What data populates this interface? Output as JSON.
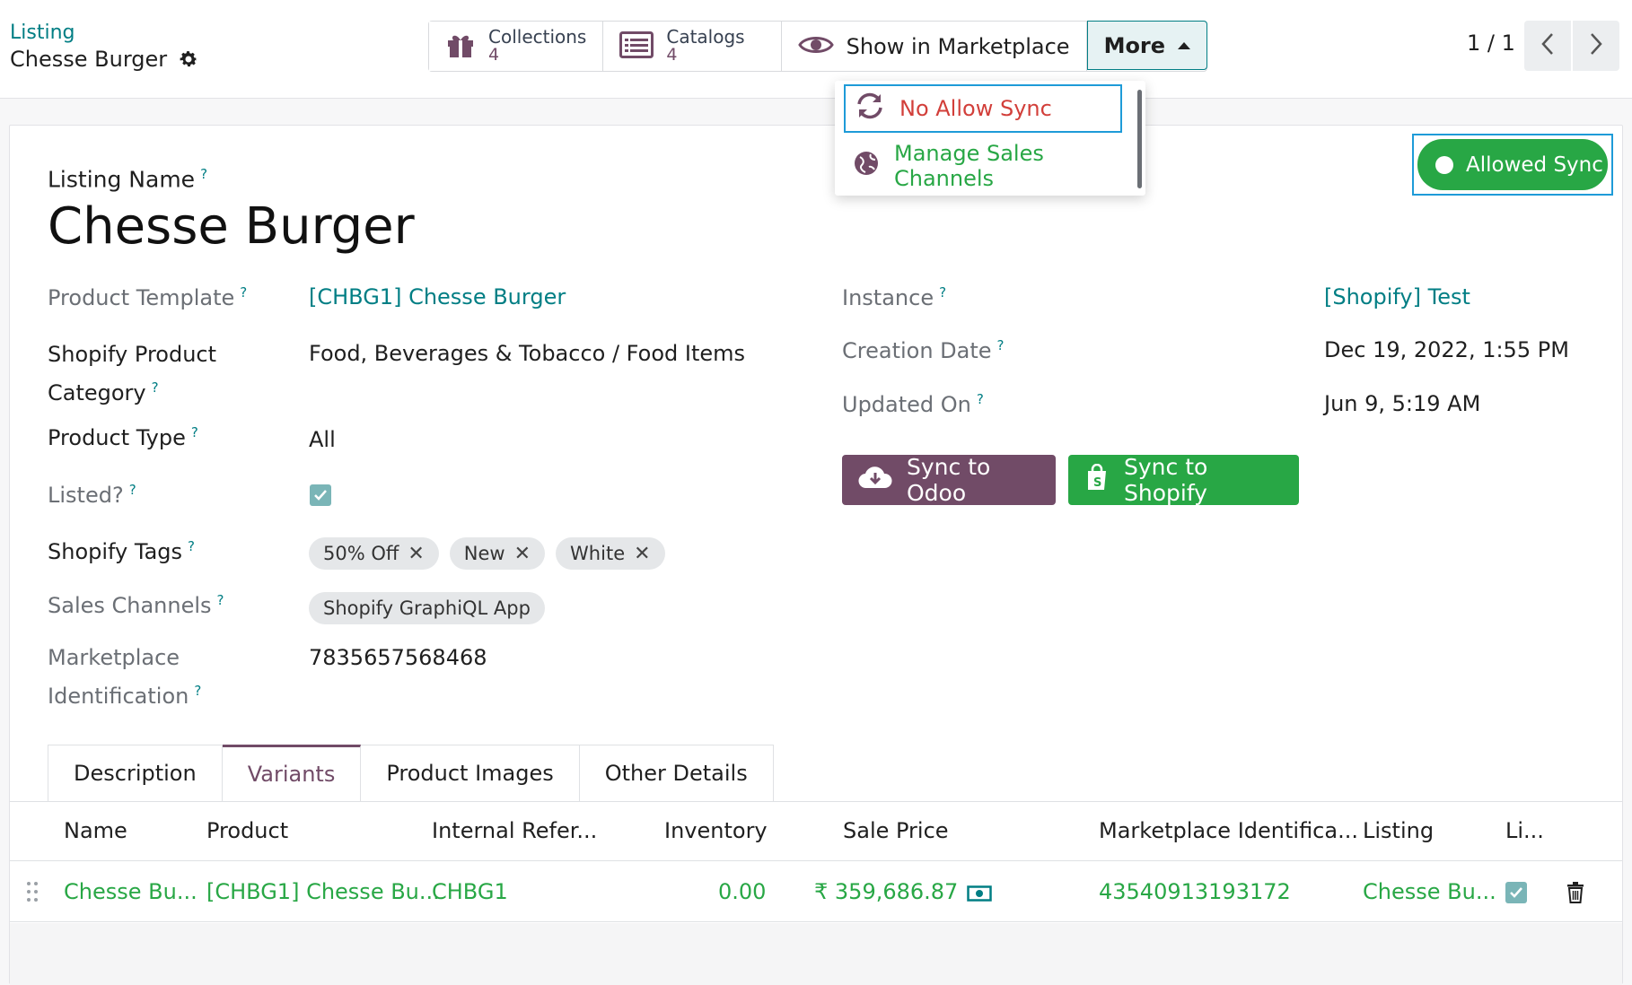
{
  "breadcrumb": {
    "parent": "Listing",
    "current": "Chesse Burger"
  },
  "smart_buttons": {
    "collections": {
      "label": "Collections",
      "count": "4"
    },
    "catalogs": {
      "label": "Catalogs",
      "count": "4"
    },
    "marketplace": {
      "label": "Show in Marketplace"
    },
    "more": {
      "label": "More"
    }
  },
  "pager": {
    "text": "1 / 1"
  },
  "dropdown": {
    "no_allow_sync": "No Allow Sync",
    "manage_channels": "Manage Sales Channels"
  },
  "status_button": {
    "label": "Allowed Sync"
  },
  "form": {
    "listing_name_label": "Listing Name",
    "listing_name": "Chesse Burger",
    "product_template_label": "Product Template",
    "product_template": "[CHBG1] Chesse Burger",
    "shopify_category_label_1": "Shopify Product",
    "shopify_category_label_2": "Category",
    "shopify_category": "Food, Beverages & Tobacco / Food Items",
    "product_type_label": "Product Type",
    "product_type": "All",
    "listed_label": "Listed?",
    "tags_label": "Shopify Tags",
    "tags": [
      "50% Off",
      "New",
      "White"
    ],
    "sales_channels_label": "Sales Channels",
    "sales_channel": "Shopify GraphiQL App",
    "marketplace_id_label_1": "Marketplace",
    "marketplace_id_label_2": "Identification",
    "marketplace_id": "7835657568468",
    "instance_label": "Instance",
    "instance": "[Shopify] Test",
    "creation_date_label": "Creation Date",
    "creation_date": "Dec 19, 2022, 1:55 PM",
    "updated_on_label": "Updated On",
    "updated_on": "Jun 9, 5:19 AM"
  },
  "actions": {
    "sync_odoo": "Sync to Odoo",
    "sync_shopify": "Sync to Shopify"
  },
  "tabs": [
    "Description",
    "Variants",
    "Product Images",
    "Other Details"
  ],
  "table": {
    "headers": [
      "Name",
      "Product",
      "Internal Refer...",
      "Inventory",
      "Sale Price",
      "Marketplace Identifica...",
      "Listing",
      "Li..."
    ],
    "row": {
      "name": "Chesse Bu...",
      "product": "[CHBG1] Chesse Bu...",
      "internal_ref": "CHBG1",
      "inventory": "0.00",
      "sale_price": "₹ 359,686.87",
      "marketplace_id": "43540913193172",
      "listing": "Chesse Bu..."
    }
  }
}
